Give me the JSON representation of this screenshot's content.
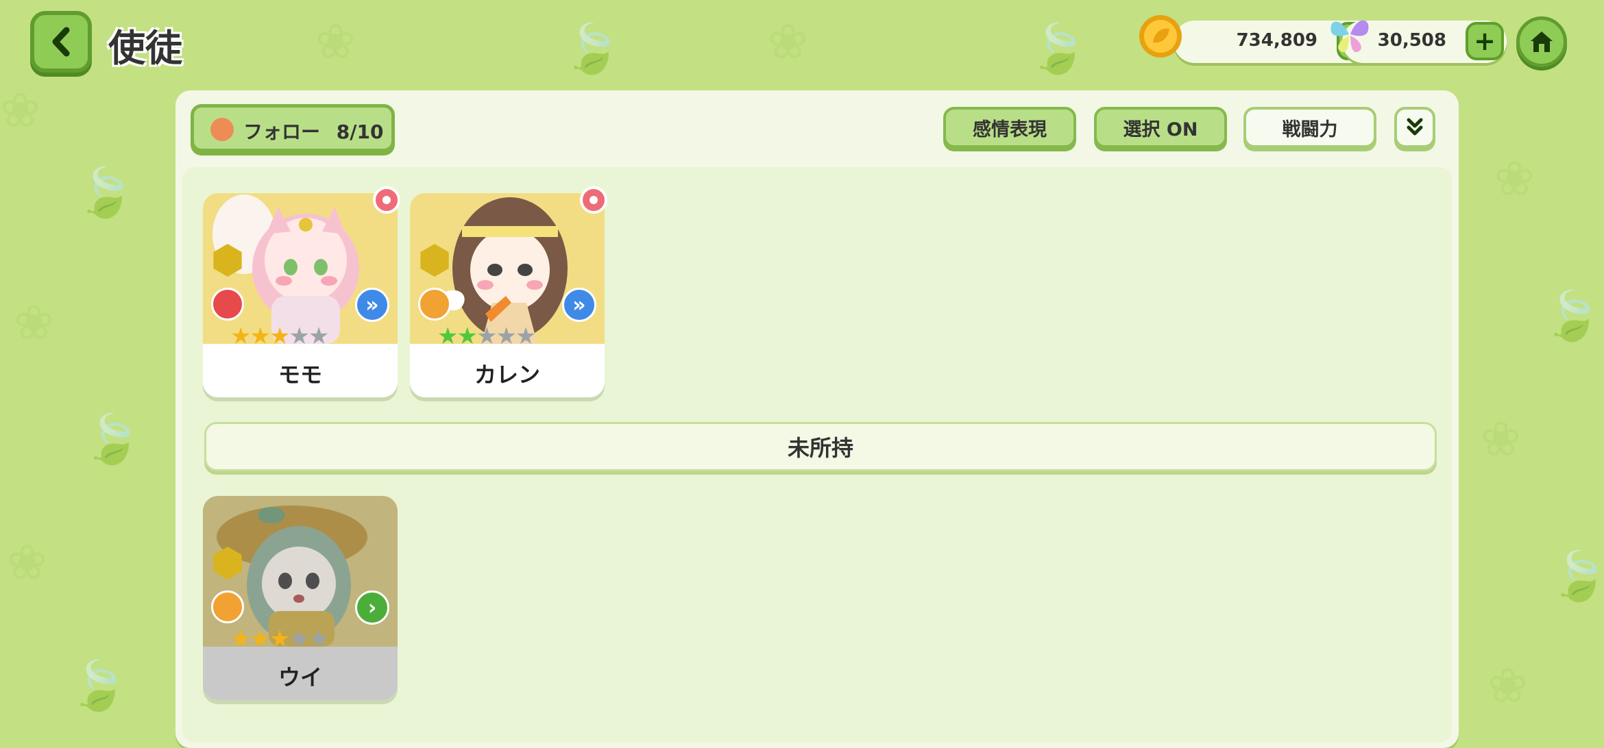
{
  "header": {
    "title": "使徒"
  },
  "currencies": [
    {
      "name": "gold-coin",
      "value": "734,809",
      "icon": "coin-leaf-icon"
    },
    {
      "name": "butterfly",
      "value": "30,508",
      "icon": "butterfly-icon"
    }
  ],
  "toolbar": {
    "follow_label": "フォロー",
    "follow_count": "8/10",
    "emotion_label": "感情表現",
    "select_label": "選択 ON",
    "power_label": "戦闘力"
  },
  "owned": [
    {
      "name": "モモ",
      "stars": 3,
      "max_stars": 5,
      "star_color": "#f3b418",
      "role_color": "#e74a4a",
      "rank_color": "#3f8ae6"
    },
    {
      "name": "カレン",
      "stars": 2,
      "max_stars": 5,
      "star_color": "#4fc93a",
      "role_color": "#f1a232",
      "rank_color": "#3f8ae6"
    }
  ],
  "section_label": "未所持",
  "unowned": [
    {
      "name": "ウイ",
      "stars": 3,
      "max_stars": 5,
      "star_color": "#f3b418",
      "role_color": "#f1a232",
      "rank_color": "#4cae3a"
    }
  ],
  "colors": {
    "background": "#c3e083",
    "accent": "#8fcc55",
    "panel": "#f3f7e6"
  }
}
